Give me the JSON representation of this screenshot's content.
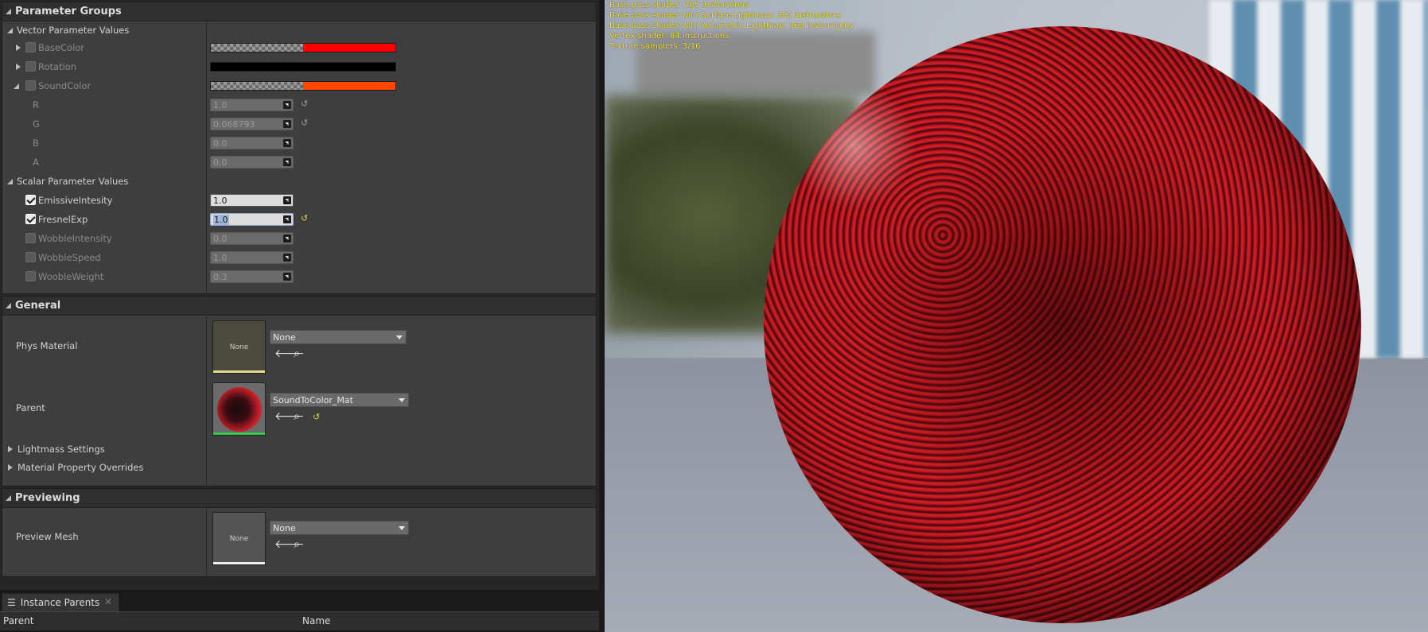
{
  "parameter_groups": {
    "title": "Parameter Groups",
    "vector_header": "Vector Parameter Values",
    "vectors": [
      {
        "name": "BaseColor",
        "color": "#ff0000"
      },
      {
        "name": "Rotation",
        "color": "#000000"
      },
      {
        "name": "SoundColor",
        "color": "#ff4600"
      }
    ],
    "components": [
      {
        "label": "R",
        "value": "1.0"
      },
      {
        "label": "G",
        "value": "0.068793"
      },
      {
        "label": "B",
        "value": "0.0"
      },
      {
        "label": "A",
        "value": "0.0"
      }
    ],
    "scalar_header": "Scalar Parameter Values",
    "scalars": [
      {
        "name": "EmissiveIntesity",
        "value": "1.0",
        "checked": true
      },
      {
        "name": "FresnelExp",
        "value": "1.0",
        "checked": true
      },
      {
        "name": "WobbleIntensity",
        "value": "0.0",
        "checked": false
      },
      {
        "name": "WobbleSpeed",
        "value": "1.0",
        "checked": false
      },
      {
        "name": "WoobleWeight",
        "value": "0.3",
        "checked": false
      }
    ]
  },
  "general": {
    "title": "General",
    "phys_material_label": "Phys Material",
    "phys_material_value": "None",
    "phys_thumb": "None",
    "parent_label": "Parent",
    "parent_value": "SoundToColor_Mat",
    "lightmass": "Lightmass Settings",
    "overrides": "Material Property Overrides"
  },
  "previewing": {
    "title": "Previewing",
    "preview_mesh_label": "Preview Mesh",
    "preview_mesh_value": "None",
    "preview_thumb": "None"
  },
  "instance_parents": {
    "tab_label": "Instance Parents",
    "col_parent": "Parent",
    "col_name": "Name"
  },
  "viewport": {
    "stats": [
      "Base pass shader: 285 instructions",
      "Base pass shader with Surface Lightmap: 302 instructions",
      "Base pass shader with Volumetric Lightmap: 368 instructions",
      "Vertex shader: 84 instructions",
      "Texture samplers: 3/16"
    ]
  }
}
